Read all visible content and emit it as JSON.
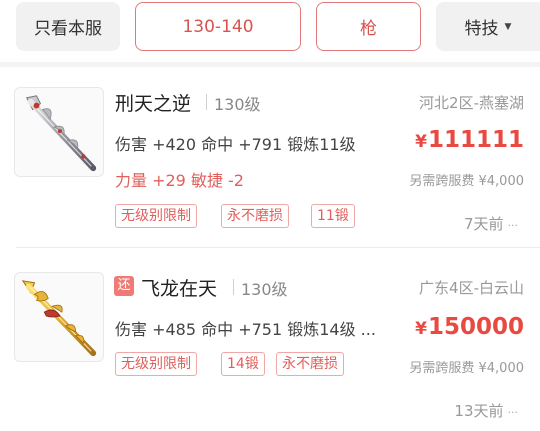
{
  "filters": {
    "server_only": "只看本服",
    "level_range": "130-140",
    "weapon_type": "枪",
    "skill": "特技"
  },
  "colors": {
    "accent": "#e84a42",
    "tag_border": "#f0a8a6",
    "chip_bg": "#f1f1f1"
  },
  "items": [
    {
      "name": "刑天之逆",
      "level": "130级",
      "stats": "伤害 +420 命中 +791 锻炼11级",
      "bonus": "力量 +29 敏捷 -2",
      "tags": [
        "无级别限制",
        "永不磨损",
        "11锻"
      ],
      "server": "河北2区-燕塞湖",
      "price_symbol": "¥",
      "price": "111111",
      "fee": "另需跨服费 ¥4,000",
      "time": "7天前",
      "more": "···",
      "icon": "spear-silver-icon"
    },
    {
      "badge": "还",
      "name": "飞龙在天",
      "level": "130级",
      "stats": "伤害 +485 命中 +751 锻炼14级 ...",
      "tags": [
        "无级别限制",
        "14锻",
        "永不磨损"
      ],
      "server": "广东4区-白云山",
      "price_symbol": "¥",
      "price": "150000",
      "fee": "另需跨服费 ¥4,000",
      "time": "13天前",
      "more": "···",
      "icon": "spear-dragon-gold-icon"
    }
  ]
}
